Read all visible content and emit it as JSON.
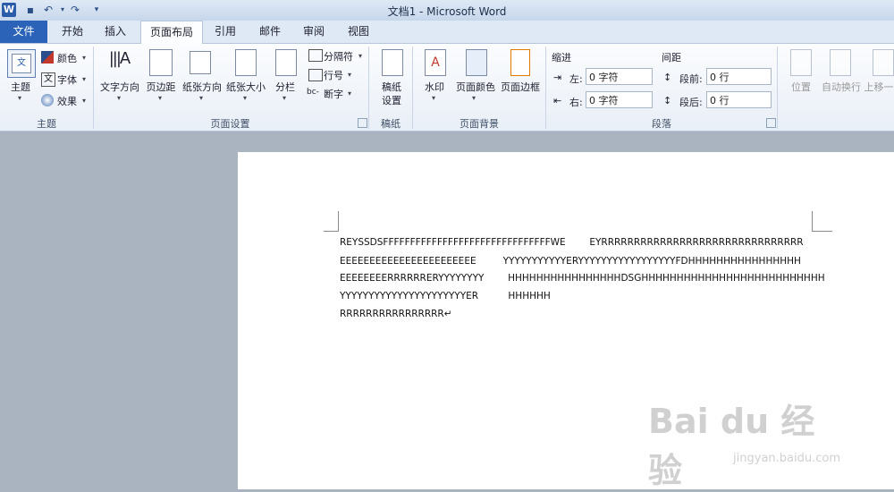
{
  "window": {
    "title": "文档1  -  Microsoft Word"
  },
  "tabs": [
    "文件",
    "开始",
    "插入",
    "页面布局",
    "引用",
    "邮件",
    "审阅",
    "视图"
  ],
  "groups": {
    "theme": {
      "label": "主题",
      "btn": "主题",
      "colors": "颜色",
      "fonts": "字体",
      "effects": "效果"
    },
    "page_setup": {
      "label": "页面设置",
      "text_dir": "文字方向",
      "margins": "页边距",
      "orientation": "纸张方向",
      "size": "纸张大小",
      "columns": "分栏",
      "breaks": "分隔符",
      "line_numbers": "行号",
      "hyphenation": "断字"
    },
    "manuscript": {
      "label": "稿纸",
      "btn": "稿纸\n设置",
      "btn1": "稿纸",
      "btn2": "设置"
    },
    "background": {
      "label": "页面背景",
      "watermark": "水印",
      "page_color": "页面颜色",
      "borders": "页面边框"
    },
    "paragraph": {
      "label": "段落",
      "indent_title": "缩进",
      "spacing_title": "间距",
      "left_label": "左:",
      "left_value": "0 字符",
      "right_label": "右:",
      "right_value": "0 字符",
      "before_label": "段前:",
      "before_value": "0 行",
      "after_label": "段后:",
      "after_value": "0 行"
    },
    "arrange": {
      "position": "位置",
      "wrap": "自动换行",
      "bring_forward": "上移一"
    }
  },
  "document": {
    "lines": [
      "REYSSDSFFFFFFFFFFFFFFFFFFFFFFFFFFFFFFFWE        EYRRRRRRRRRRRRRRRRRRRRRRRRRRRRRRR",
      "EEEEEEEEEEEEEEEEEEEEEEE         YYYYYYYYYYYERYYYYYYYYYYYYYYYYYFDHHHHHHHHHHHHHHHH",
      "EEEEEEEERRRRRRERYYYYYYYY        HHHHHHHHHHHHHHHHDSGHHHHHHHHHHHHHHHHHHHHHHHHHH",
      "YYYYYYYYYYYYYYYYYYYYYYER          HHHHHH",
      "RRRRRRRRRRRRRRRR↵"
    ]
  },
  "watermark": {
    "logo": "Bai du 经验",
    "url": "jingyan.baidu.com"
  }
}
